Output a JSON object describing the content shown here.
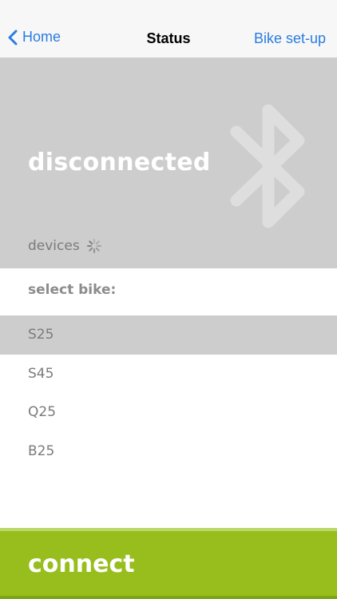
{
  "navbar": {
    "back_label": "Home",
    "title": "Status",
    "right_label": "Bike set-up"
  },
  "status": {
    "connection_text": "disconnected",
    "devices_label": "devices",
    "icon": "bluetooth-icon"
  },
  "bike_selection": {
    "label": "select bike:",
    "items": [
      {
        "label": "S25",
        "selected": true
      },
      {
        "label": "S45",
        "selected": false
      },
      {
        "label": "Q25",
        "selected": false
      },
      {
        "label": "B25",
        "selected": false
      }
    ]
  },
  "connect_button": {
    "label": "connect"
  },
  "colors": {
    "accent_blue": "#2a7de1",
    "panel_gray": "#cdcdcd",
    "connect_green": "#97be1d"
  }
}
